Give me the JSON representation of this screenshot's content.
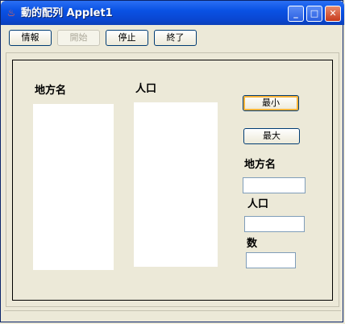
{
  "window": {
    "title": "動的配列 Applet1",
    "icon": "java-cup-icon",
    "controls": {
      "minimize": "_",
      "maximize": "□",
      "close": "✕"
    }
  },
  "toolbar": {
    "info_label": "情報",
    "start_label": "開始",
    "stop_label": "停止",
    "exit_label": "終了"
  },
  "main": {
    "region_header": "地方名",
    "population_header": "人口",
    "min_button": "最小",
    "max_button": "最大",
    "region_label": "地方名",
    "population_label": "人口",
    "count_label": "数",
    "region_value": "",
    "population_value": "",
    "count_value": ""
  }
}
